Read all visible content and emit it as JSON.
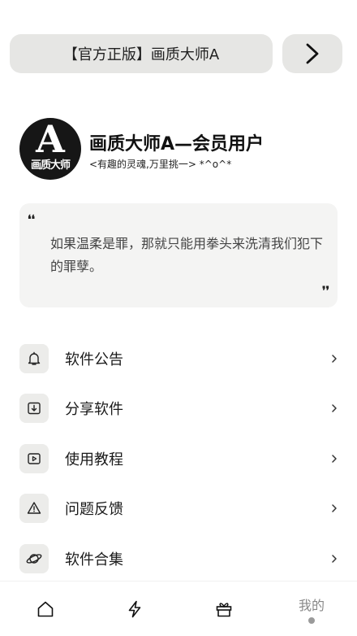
{
  "header": {
    "title": "【官方正版】画质大师A",
    "next_icon": "chevron-right-icon"
  },
  "profile": {
    "avatar_letter": "A",
    "avatar_brand": "画质大师",
    "name": "画质大师A—会员用户",
    "motto": "<有趣的灵魂,万里挑一> *^o^*"
  },
  "quote": {
    "open_mark": "❛❛",
    "text": "如果温柔是罪，那就只能用拳头来洗清我们犯下的罪孽。",
    "close_mark": "❜❜"
  },
  "menu": {
    "items": [
      {
        "label": "软件公告",
        "icon": "bell-icon"
      },
      {
        "label": "分享软件",
        "icon": "share-download-icon"
      },
      {
        "label": "使用教程",
        "icon": "play-video-icon"
      },
      {
        "label": "问题反馈",
        "icon": "warning-icon"
      },
      {
        "label": "软件合集",
        "icon": "planet-icon"
      }
    ]
  },
  "bottom_nav": {
    "items": [
      {
        "icon": "home-icon"
      },
      {
        "icon": "lightning-icon"
      },
      {
        "icon": "gift-icon"
      },
      {
        "label": "我的"
      }
    ],
    "active_index": 3
  }
}
